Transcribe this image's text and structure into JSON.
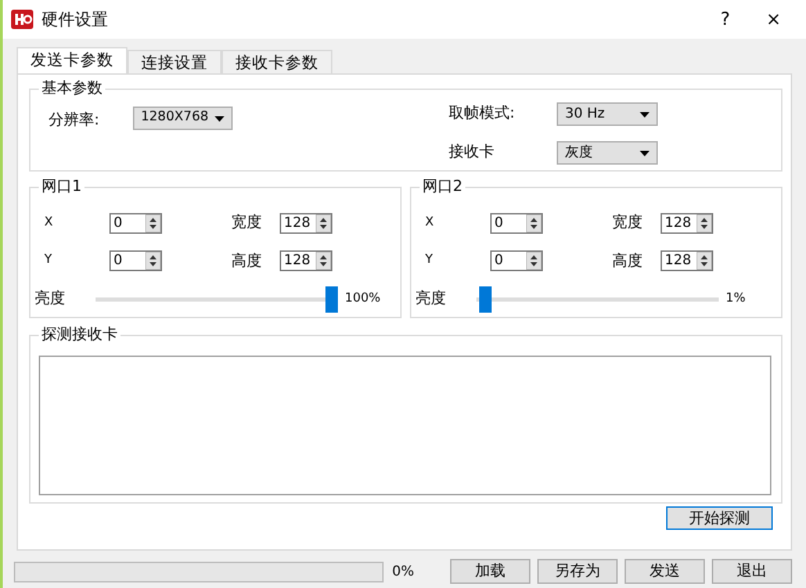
{
  "window": {
    "title": "硬件设置",
    "help": "?",
    "close": "×"
  },
  "tabs": [
    {
      "label": "发送卡参数",
      "selected": true
    },
    {
      "label": "连接设置",
      "selected": false
    },
    {
      "label": "接收卡参数",
      "selected": false
    }
  ],
  "basic": {
    "title": "基本参数",
    "resolution": {
      "label": "分辨率:",
      "value": "1280X768"
    },
    "frame_mode": {
      "label": "取帧模式:",
      "value": "30 Hz"
    },
    "receiver": {
      "label": "接收卡",
      "value": "灰度"
    }
  },
  "ports": [
    {
      "title": "网口1",
      "x": {
        "label": "X",
        "value": "0"
      },
      "y": {
        "label": "Y",
        "value": "0"
      },
      "width": {
        "label": "宽度",
        "value": "128"
      },
      "height": {
        "label": "高度",
        "value": "128"
      },
      "brightness": {
        "label": "亮度",
        "level": 1,
        "reading": "100%"
      }
    },
    {
      "title": "网口2",
      "x": {
        "label": "X",
        "value": "0"
      },
      "y": {
        "label": "Y",
        "value": "0"
      },
      "width": {
        "label": "宽度",
        "value": "128"
      },
      "height": {
        "label": "高度",
        "value": "128"
      },
      "brightness": {
        "label": "亮度",
        "level": 0.01,
        "reading": "1%"
      }
    }
  ],
  "detect": {
    "title": "探测接收卡",
    "button": "开始探测"
  },
  "progress": {
    "level": 0,
    "reading": "0%"
  },
  "buttons": [
    "加载",
    "另存为",
    "发送",
    "退出"
  ]
}
